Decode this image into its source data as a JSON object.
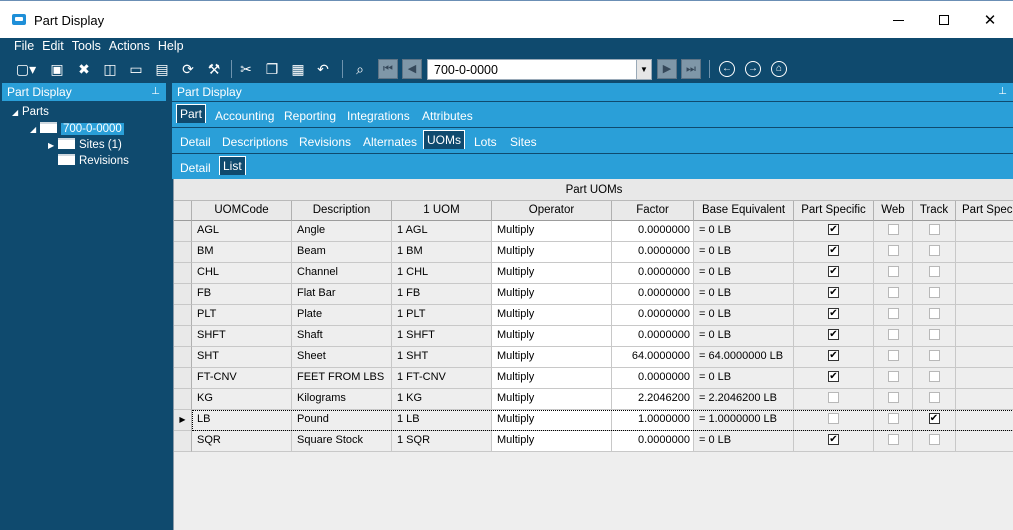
{
  "window": {
    "title": "Part Display"
  },
  "menu": [
    "File",
    "Edit",
    "Tools",
    "Actions",
    "Help"
  ],
  "toolbar": {
    "part_number": "700-0-0000"
  },
  "left_panel": {
    "title": "Part Display",
    "tree": {
      "root": "Parts",
      "part": "700-0-0000",
      "sites": "Sites (1)",
      "revisions": "Revisions"
    }
  },
  "right_panel": {
    "title": "Part Display",
    "tabs_level1": [
      "Part",
      "Accounting",
      "Reporting",
      "Integrations",
      "Attributes"
    ],
    "tabs_level2": [
      "Detail",
      "Descriptions",
      "Revisions",
      "Alternates",
      "UOMs",
      "Lots",
      "Sites"
    ],
    "tabs_level3": [
      "Detail",
      "List"
    ],
    "active": {
      "level1": "Part",
      "level2": "UOMs",
      "level3": "List"
    }
  },
  "grid": {
    "title": "Part UOMs",
    "columns": [
      "UOMCode",
      "Description",
      "1 UOM",
      "Operator",
      "Factor",
      "Base Equivalent",
      "Part Specific",
      "Web",
      "Track",
      "Part Spec"
    ],
    "rows": [
      {
        "code": "AGL",
        "desc": "Angle",
        "uom": "1 AGL",
        "op": "Multiply",
        "factor": "0.0000000",
        "base": "= 0 LB",
        "part_specific": true,
        "web": false,
        "track": false
      },
      {
        "code": "BM",
        "desc": "Beam",
        "uom": "1 BM",
        "op": "Multiply",
        "factor": "0.0000000",
        "base": "= 0 LB",
        "part_specific": true,
        "web": false,
        "track": false
      },
      {
        "code": "CHL",
        "desc": "Channel",
        "uom": "1 CHL",
        "op": "Multiply",
        "factor": "0.0000000",
        "base": "= 0 LB",
        "part_specific": true,
        "web": false,
        "track": false
      },
      {
        "code": "FB",
        "desc": "Flat Bar",
        "uom": "1 FB",
        "op": "Multiply",
        "factor": "0.0000000",
        "base": "= 0 LB",
        "part_specific": true,
        "web": false,
        "track": false
      },
      {
        "code": "PLT",
        "desc": "Plate",
        "uom": "1 PLT",
        "op": "Multiply",
        "factor": "0.0000000",
        "base": "= 0 LB",
        "part_specific": true,
        "web": false,
        "track": false
      },
      {
        "code": "SHFT",
        "desc": "Shaft",
        "uom": "1 SHFT",
        "op": "Multiply",
        "factor": "0.0000000",
        "base": "= 0 LB",
        "part_specific": true,
        "web": false,
        "track": false
      },
      {
        "code": "SHT",
        "desc": "Sheet",
        "uom": "1 SHT",
        "op": "Multiply",
        "factor": "64.0000000",
        "base": "= 64.0000000 LB",
        "part_specific": true,
        "web": false,
        "track": false
      },
      {
        "code": "FT-CNV",
        "desc": "FEET FROM LBS",
        "uom": "1 FT-CNV",
        "op": "Multiply",
        "factor": "0.0000000",
        "base": "= 0 LB",
        "part_specific": true,
        "web": false,
        "track": false
      },
      {
        "code": "KG",
        "desc": "Kilograms",
        "uom": "1 KG",
        "op": "Multiply",
        "factor": "2.2046200",
        "base": "= 2.2046200 LB",
        "part_specific": false,
        "web": false,
        "track": false
      },
      {
        "code": "LB",
        "desc": "Pound",
        "uom": "1 LB",
        "op": "Multiply",
        "factor": "1.0000000",
        "base": "= 1.0000000 LB",
        "part_specific": false,
        "web": false,
        "track": true,
        "current": true
      },
      {
        "code": "SQR",
        "desc": "Square Stock",
        "uom": "1 SQR",
        "op": "Multiply",
        "factor": "0.0000000",
        "base": "= 0 LB",
        "part_specific": true,
        "web": false,
        "track": false
      }
    ]
  },
  "colors": {
    "navy": "#0f4a6e",
    "accent": "#2a9fd8"
  }
}
